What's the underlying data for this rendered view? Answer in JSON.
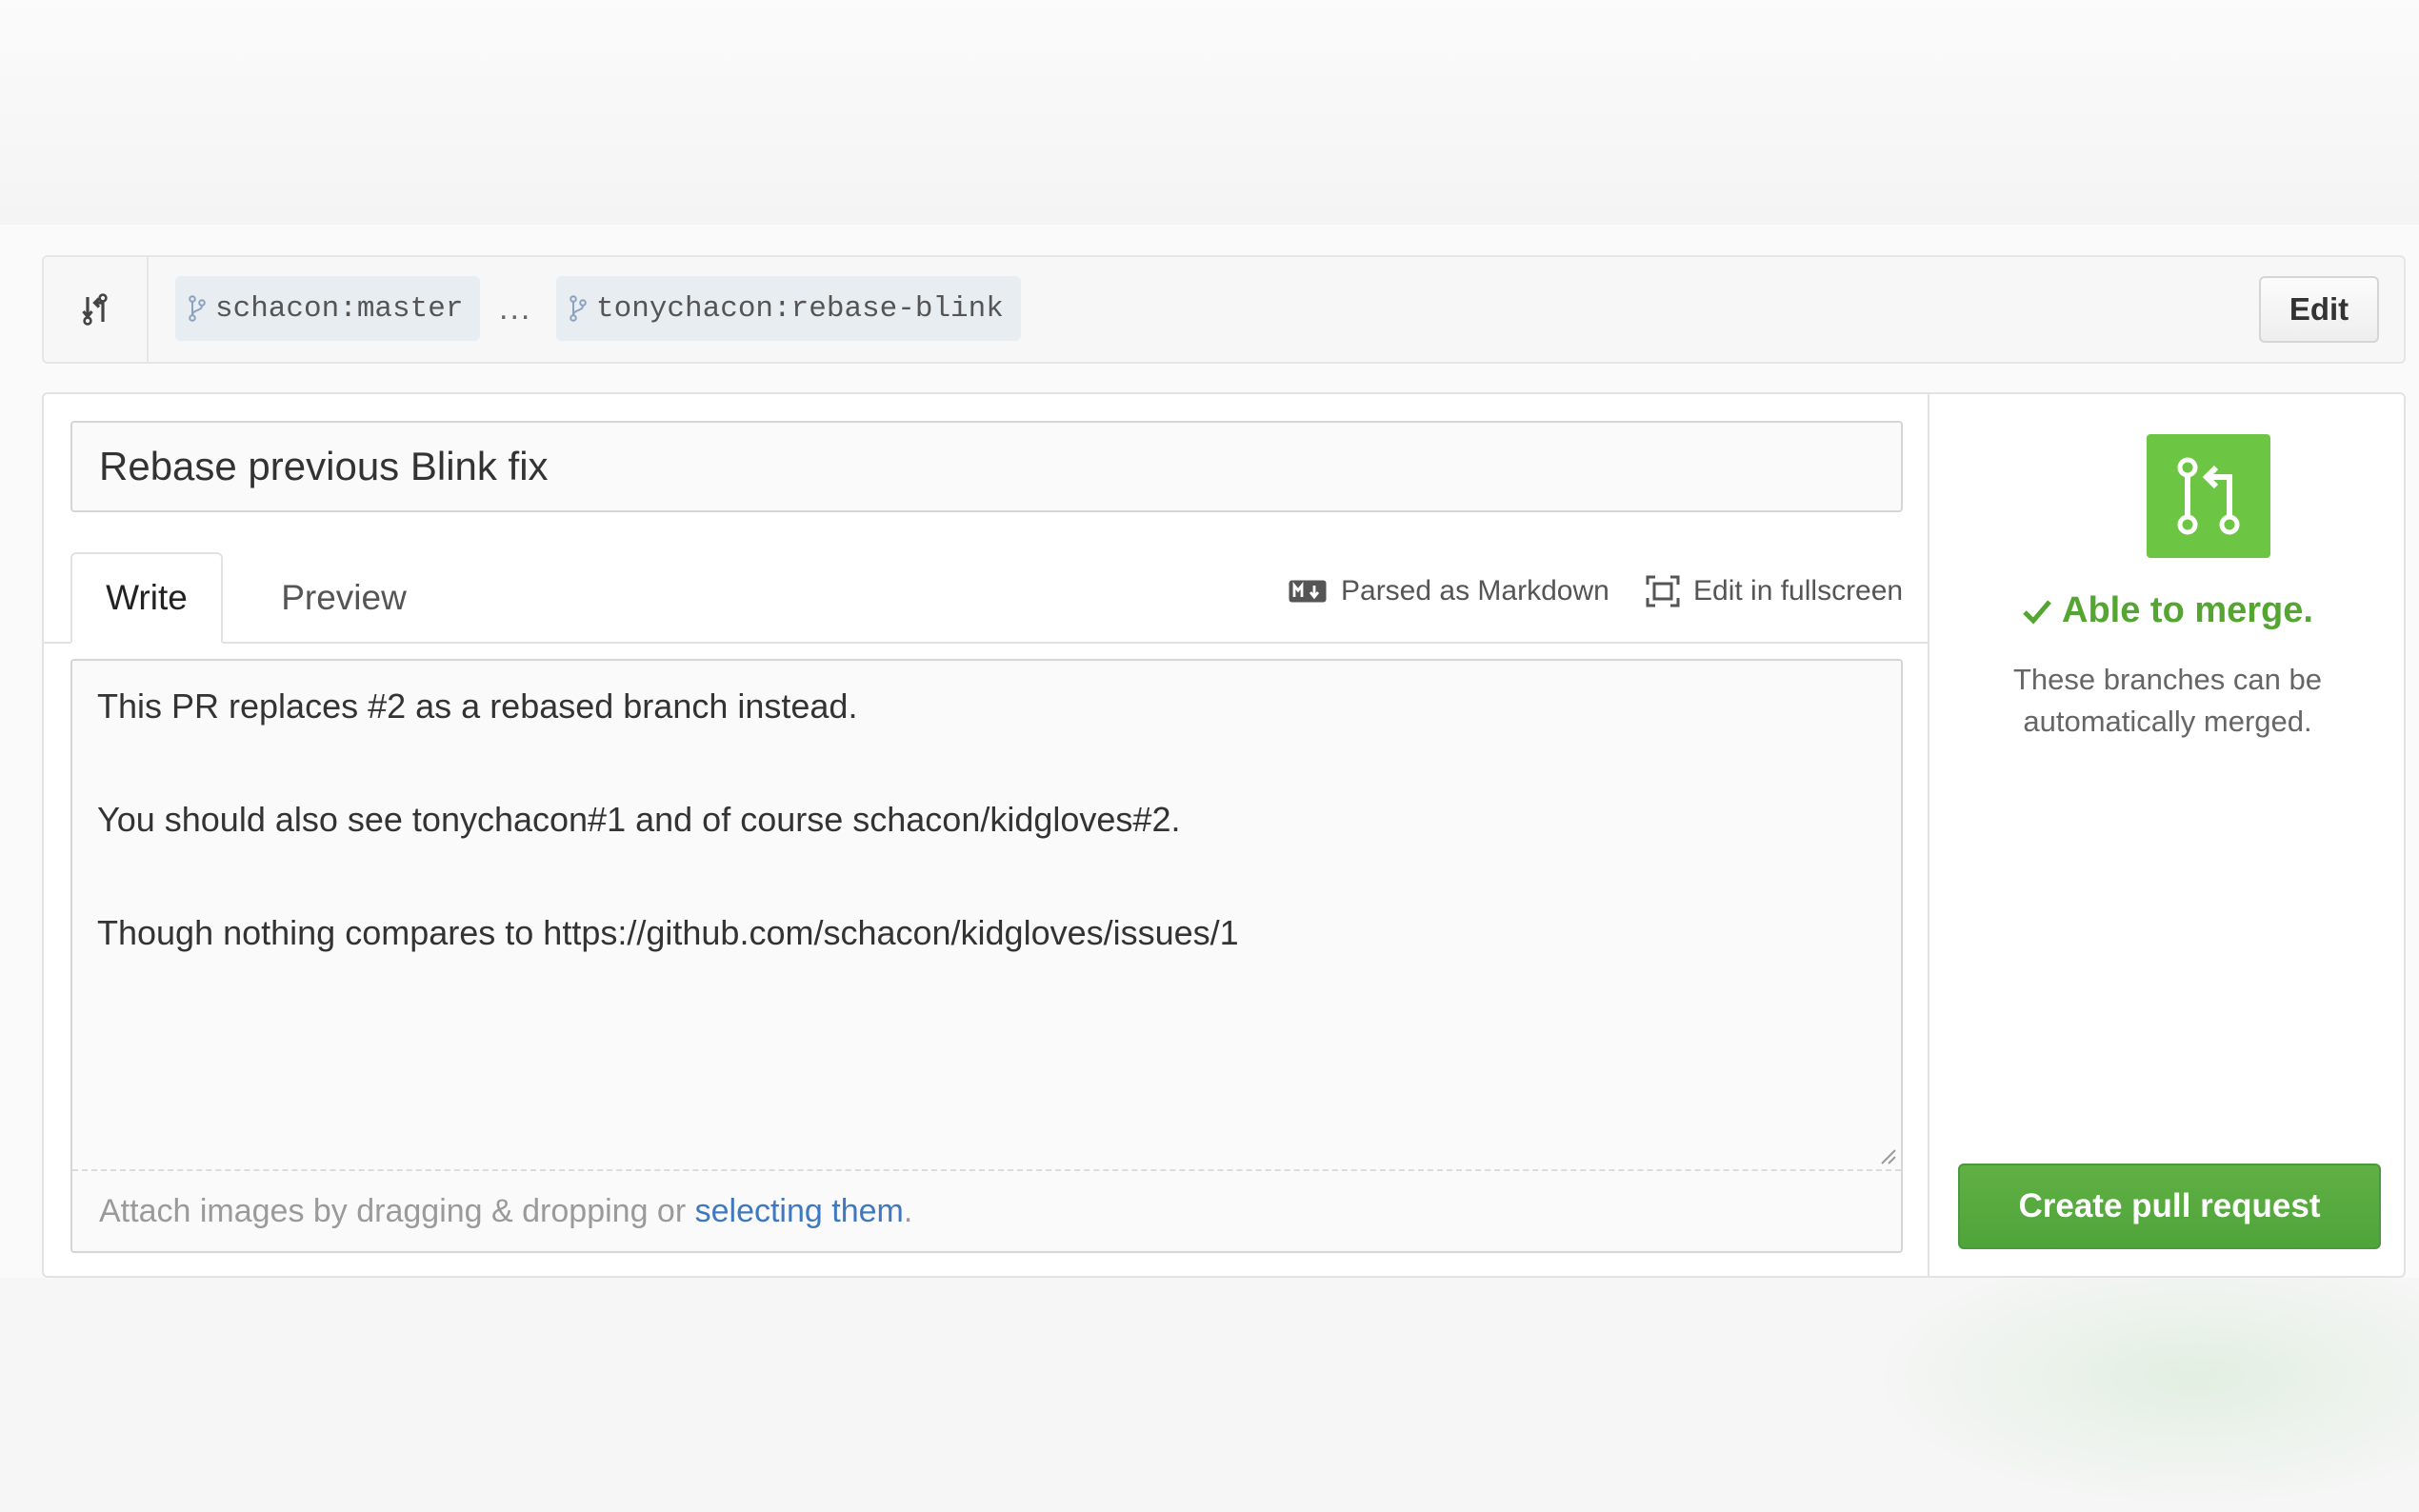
{
  "range": {
    "base_branch": "schacon:master",
    "separator": "...",
    "head_branch": "tonychacon:rebase-blink",
    "edit_label": "Edit"
  },
  "form": {
    "title_value": "Rebase previous Blink fix",
    "tabs": [
      {
        "label": "Write",
        "active": true
      },
      {
        "label": "Preview",
        "active": false
      }
    ],
    "toolbar": {
      "markdown_label": "Parsed as Markdown",
      "fullscreen_label": "Edit in fullscreen"
    },
    "body_lines": [
      "This PR replaces #2 as a rebased branch instead.",
      "You should also see tonychacon#1 and of course schacon/kidgloves#2.",
      "Though nothing compares to https://github.com/schacon/kidgloves/issues/1"
    ],
    "attach": {
      "prefix": "Attach images by dragging & dropping or ",
      "link": "selecting them",
      "suffix": "."
    }
  },
  "sidebar": {
    "status": "Able to merge.",
    "description": "These branches can be automatically merged.",
    "create_label": "Create pull request"
  },
  "colors": {
    "accent_green": "#6cc644",
    "merge_text_green": "#55a532",
    "link_blue": "#4078c0"
  },
  "icons": {
    "compare": "git-compare-icon",
    "branch": "git-branch-icon",
    "markdown": "markdown-icon",
    "fullscreen": "screen-full-icon",
    "merge": "git-pull-request-icon",
    "check": "check-icon"
  }
}
